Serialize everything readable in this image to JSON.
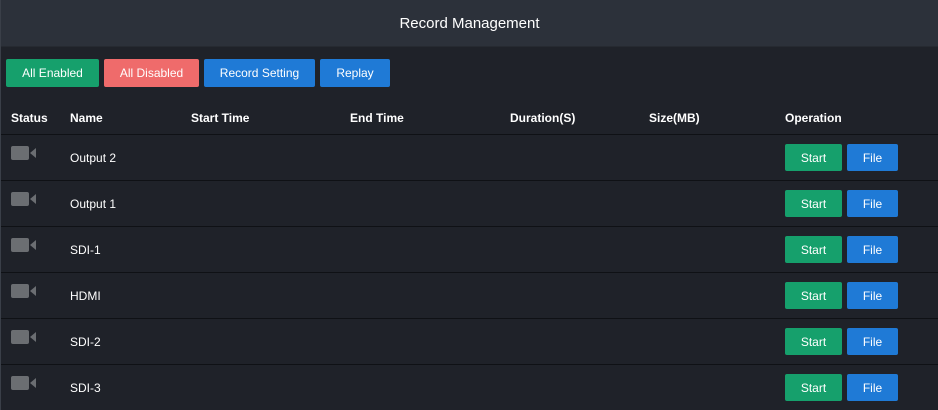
{
  "header": {
    "title": "Record Management"
  },
  "toolbar": {
    "all_enabled": "All Enabled",
    "all_disabled": "All Disabled",
    "record_setting": "Record Setting",
    "replay": "Replay"
  },
  "table": {
    "columns": {
      "status": "Status",
      "name": "Name",
      "start_time": "Start Time",
      "end_time": "End Time",
      "duration": "Duration(S)",
      "size": "Size(MB)",
      "operation": "Operation"
    },
    "rows": [
      {
        "status_icon": "video-camera-icon",
        "name": "Output 2",
        "start_time": "",
        "end_time": "",
        "duration": "",
        "size": "",
        "start_label": "Start",
        "file_label": "File"
      },
      {
        "status_icon": "video-camera-icon",
        "name": "Output 1",
        "start_time": "",
        "end_time": "",
        "duration": "",
        "size": "",
        "start_label": "Start",
        "file_label": "File"
      },
      {
        "status_icon": "video-camera-icon",
        "name": "SDI-1",
        "start_time": "",
        "end_time": "",
        "duration": "",
        "size": "",
        "start_label": "Start",
        "file_label": "File"
      },
      {
        "status_icon": "video-camera-icon",
        "name": "HDMI",
        "start_time": "",
        "end_time": "",
        "duration": "",
        "size": "",
        "start_label": "Start",
        "file_label": "File"
      },
      {
        "status_icon": "video-camera-icon",
        "name": "SDI-2",
        "start_time": "",
        "end_time": "",
        "duration": "",
        "size": "",
        "start_label": "Start",
        "file_label": "File"
      },
      {
        "status_icon": "video-camera-icon",
        "name": "SDI-3",
        "start_time": "",
        "end_time": "",
        "duration": "",
        "size": "",
        "start_label": "Start",
        "file_label": "File"
      }
    ]
  },
  "colors": {
    "green": "#16a06c",
    "red": "#ef6b6b",
    "blue": "#1f7ad6",
    "icon_gray": "#6b6e72"
  }
}
